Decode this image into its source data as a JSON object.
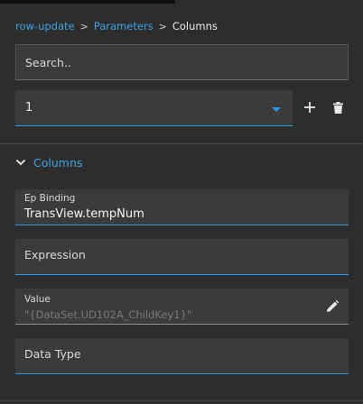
{
  "breadcrumb": {
    "item1": "row-update",
    "item2": "Parameters",
    "item3": "Columns",
    "separator": ">"
  },
  "search": {
    "placeholder": "Search.."
  },
  "selector": {
    "value": "1"
  },
  "section": {
    "title": "Columns"
  },
  "fields": {
    "ep_binding_label": "Ep Binding",
    "ep_binding_value": "TransView.tempNum",
    "expression_label": "Expression",
    "value_label": "Value",
    "value_placeholder": "\"{DataSet.UD102A_ChildKey1}\"",
    "data_type_label": "Data Type"
  },
  "colors": {
    "accent": "#2b9cf2",
    "link": "#3fa3e6",
    "background": "#2d2d2d",
    "field_bg": "#3b3b3b"
  },
  "icons": {
    "add": "plus-icon",
    "delete": "trash-icon",
    "collapse": "chevron-down-icon",
    "edit": "pencil-icon",
    "dropdown": "caret-down-icon"
  }
}
